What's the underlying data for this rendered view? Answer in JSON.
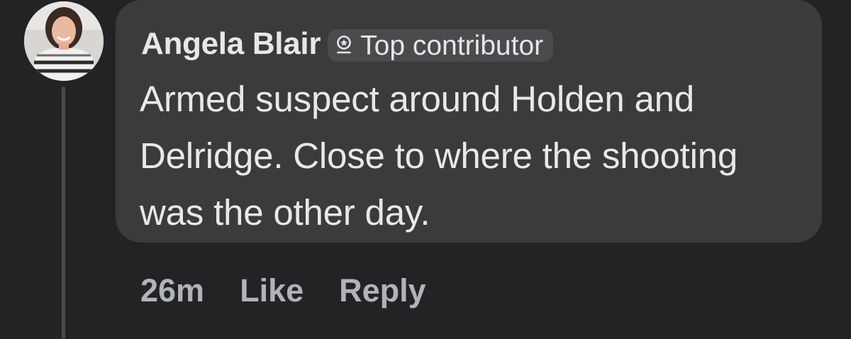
{
  "comment": {
    "author": "Angela Blair",
    "badge": {
      "icon": "top-contributor-badge-icon",
      "label": "Top contributor"
    },
    "text": "Armed suspect around Holden and Delridge. Close to where the shooting was the other day.",
    "timestamp": "26m",
    "actions": {
      "like": "Like",
      "reply": "Reply"
    }
  },
  "colors": {
    "background": "#232325",
    "bubble": "#3a3b3c",
    "badge": "#4a4b4d",
    "primary_text": "#e7e8ea",
    "secondary_text": "#b0b3b8",
    "thread_line": "#48494c"
  }
}
